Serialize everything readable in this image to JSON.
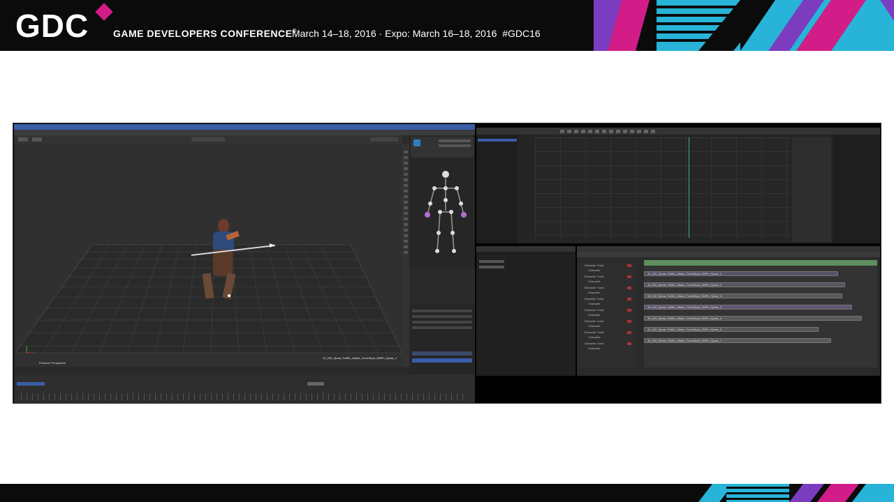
{
  "header": {
    "logo": "GDC",
    "conference_name": "GAME DEVELOPERS CONFERENCE",
    "registered_mark": "®",
    "dates": "March 14–18, 2016 · Expo: March 16–18, 2016",
    "hashtag": "#GDC16"
  },
  "colors": {
    "brand_magenta": "#d21d88",
    "brand_cyan": "#27b4d8",
    "brand_blue": "#3a5ea8",
    "brand_purple": "#7c3cc0"
  },
  "screenshot": {
    "viewport_label": "Producer Perspective",
    "take_label": "15_200_Spear_FullB1_Attack_TurnInSpot_350Pc_Spear_1",
    "story_tracks": [
      {
        "name": "Character Track",
        "char": "Character"
      },
      {
        "name": "Character Track",
        "char": "Character"
      },
      {
        "name": "Character Track",
        "char": "Character"
      },
      {
        "name": "Character Track",
        "char": "Character"
      },
      {
        "name": "Character Track",
        "char": "Character"
      },
      {
        "name": "Character Track",
        "char": "Character"
      },
      {
        "name": "Character Track",
        "char": "Character"
      },
      {
        "name": "Character Track",
        "char": "Character"
      }
    ],
    "clip_labels": [
      "15_200_Spear_FullB1_Attack_TurnInSpot_350Pc_Spear_1",
      "15_200_Spear_FullB1_Attack_TurnInSpot_350Pc_Spear_2",
      "15_200_Spear_FullB1_Attack_TurnInSpot_350Pc_Spear_3",
      "15_200_Spear_FullB1_Attack_TurnInSpot_350Pc_Spear_4",
      "15_200_Spear_FullB1_Attack_TurnInSpot_350Pc_Spear_5",
      "15_200_Spear_FullB1_Attack_TurnInSpot_350Pc_Spear_6",
      "15_200_Spear_FullB1_Attack_TurnInSpot_350Pc_Spear_7"
    ]
  }
}
